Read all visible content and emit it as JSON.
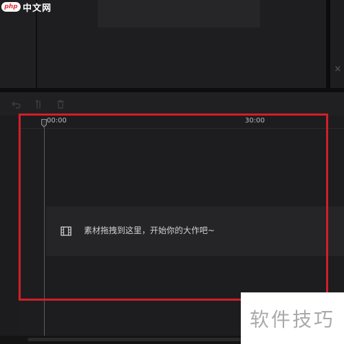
{
  "logo": {
    "badge_text": "php",
    "site_name": "中文网"
  },
  "preview": {
    "close_icon": "close-icon"
  },
  "toolbar": {
    "buttons": [
      {
        "name": "undo-icon"
      },
      {
        "name": "split-icon"
      },
      {
        "name": "delete-icon"
      }
    ]
  },
  "timeline": {
    "time_labels": [
      "00:00",
      "30:00"
    ],
    "drop_zone_text": "素材拖拽到这里，开始你的大作吧~",
    "drop_icon": "film-icon"
  },
  "watermark": {
    "text": "软件技巧"
  },
  "colors": {
    "background": "#1c1c1e",
    "highlight_border": "#d41f27",
    "drop_zone": "#252527",
    "logo_red": "#e5303b"
  }
}
